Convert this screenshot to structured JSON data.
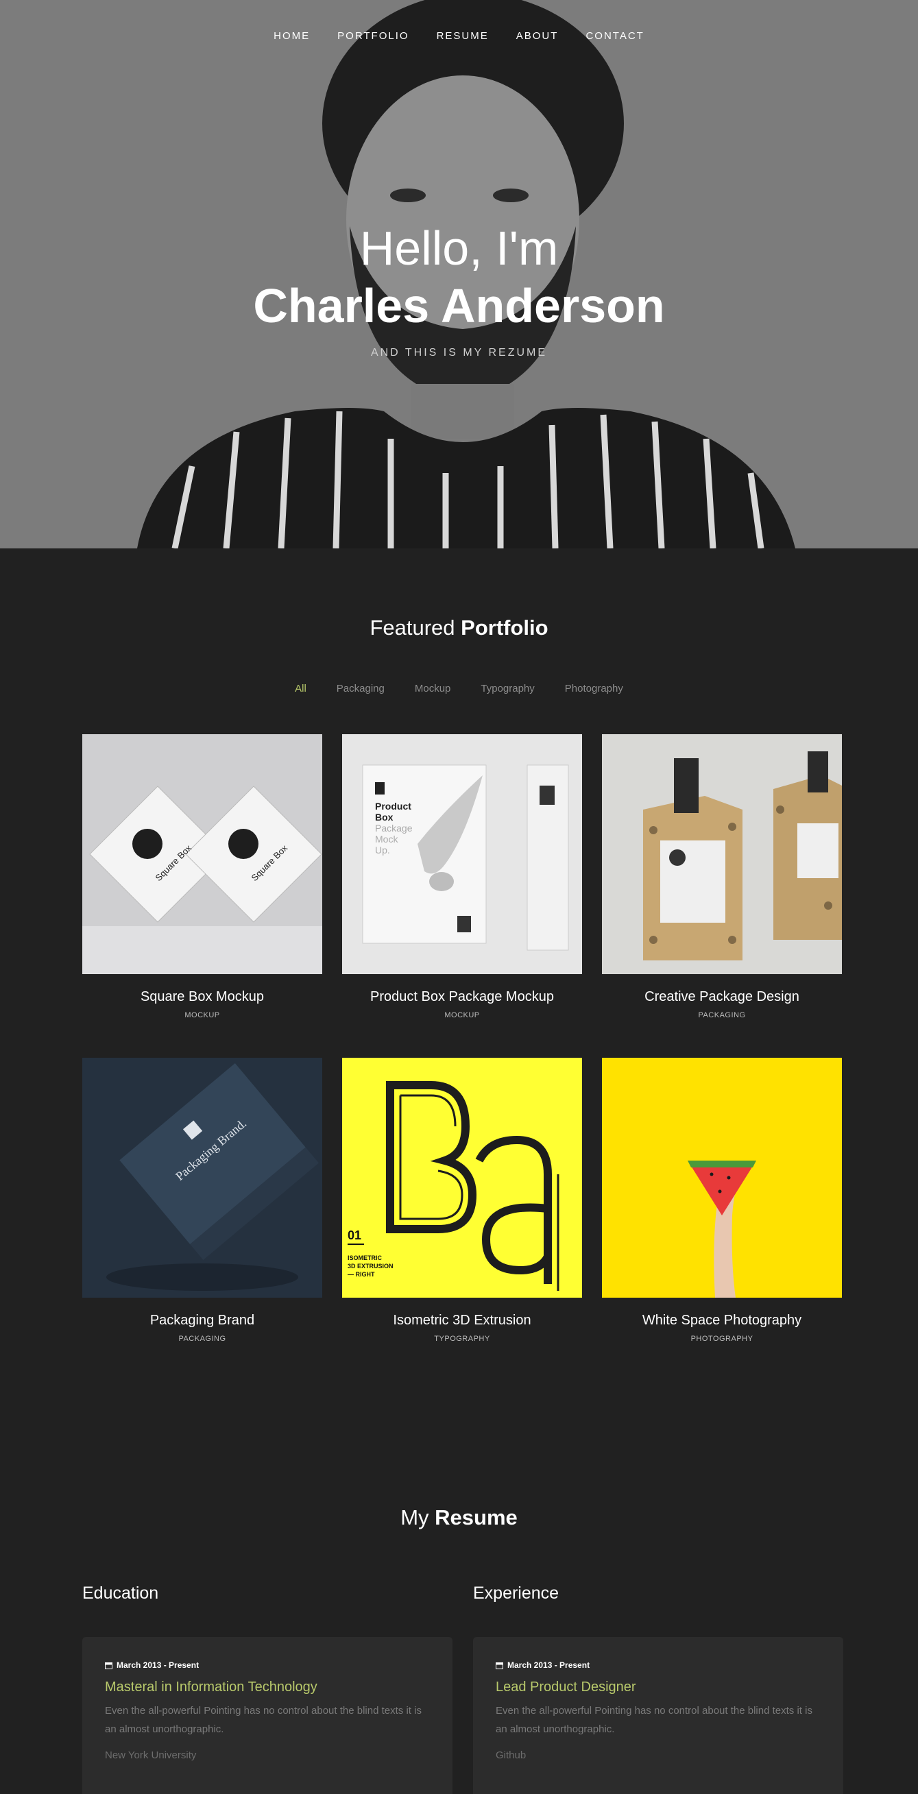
{
  "nav": {
    "items": [
      "HOME",
      "PORTFOLIO",
      "RESUME",
      "ABOUT",
      "CONTACT"
    ]
  },
  "hero": {
    "greeting": "Hello, I'm",
    "name": "Charles Anderson",
    "subtitle": "AND THIS IS MY REZUME"
  },
  "portfolio": {
    "title_light": "Featured ",
    "title_bold": "Portfolio",
    "filters": [
      "All",
      "Packaging",
      "Mockup",
      "Typography",
      "Photography"
    ],
    "items": [
      {
        "title": "Square Box Mockup",
        "category": "MOCKUP"
      },
      {
        "title": "Product Box Package Mockup",
        "category": "MOCKUP"
      },
      {
        "title": "Creative Package Design",
        "category": "PACKAGING"
      },
      {
        "title": "Packaging Brand",
        "category": "PACKAGING"
      },
      {
        "title": "Isometric 3D Extrusion",
        "category": "TYPOGRAPHY"
      },
      {
        "title": "White Space Photography",
        "category": "PHOTOGRAPHY"
      }
    ],
    "thumb_text": {
      "box1": "Square Box",
      "box2": "Product Box Package Mock Up.",
      "brand": "Packaging Brand.",
      "iso_num": "01",
      "iso_lines": [
        "ISOMETRIC",
        "3D EXTRUSION",
        "— RIGHT"
      ]
    }
  },
  "resume": {
    "title_light": "My ",
    "title_bold": "Resume",
    "education": {
      "heading": "Education",
      "date": "March 2013 - Present",
      "role": "Masteral in Information Technology",
      "desc": "Even the all-powerful Pointing has no control about the blind texts it is an almost unorthographic.",
      "org": "New York University"
    },
    "experience": {
      "heading": "Experience",
      "date": "March 2013 - Present",
      "role": "Lead Product Designer",
      "desc": "Even the all-powerful Pointing has no control about the blind texts it is an almost unorthographic.",
      "org": "Github"
    }
  },
  "colors": {
    "accent": "#b8c96b",
    "background": "#212121",
    "card": "#2c2c2c"
  }
}
